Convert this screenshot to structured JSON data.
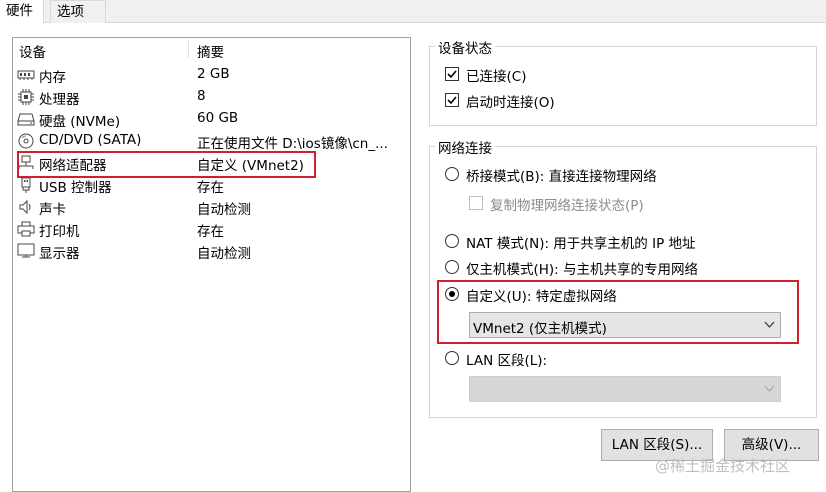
{
  "tabs": [
    {
      "label": "硬件",
      "active": true
    },
    {
      "label": "选项",
      "active": false
    }
  ],
  "device_list": {
    "headers": {
      "device": "设备",
      "summary": "摘要"
    },
    "rows": [
      {
        "icon": "memory-icon",
        "name": "内存",
        "summary": "2 GB"
      },
      {
        "icon": "processor-icon",
        "name": "处理器",
        "summary": "8"
      },
      {
        "icon": "harddisk-icon",
        "name": "硬盘 (NVMe)",
        "summary": "60 GB"
      },
      {
        "icon": "cd-dvd-icon",
        "name": "CD/DVD (SATA)",
        "summary": "正在使用文件 D:\\ios镜像\\cn_..."
      },
      {
        "icon": "network-adapter-icon",
        "name": "网络适配器",
        "summary": "自定义 (VMnet2)",
        "selected": true
      },
      {
        "icon": "usb-icon",
        "name": "USB 控制器",
        "summary": "存在"
      },
      {
        "icon": "speaker-icon",
        "name": "声卡",
        "summary": "自动检测"
      },
      {
        "icon": "printer-icon",
        "name": "打印机",
        "summary": "存在"
      },
      {
        "icon": "display-icon",
        "name": "显示器",
        "summary": "自动检测"
      }
    ]
  },
  "device_status": {
    "title": "设备状态",
    "connected": {
      "label": "已连接(C)",
      "checked": true
    },
    "connect_at_power_on": {
      "label": "启动时连接(O)",
      "checked": true
    }
  },
  "network_connection": {
    "title": "网络连接",
    "bridged": {
      "label": "桥接模式(B): 直接连接物理网络",
      "selected": false
    },
    "replicate": {
      "label": "复制物理网络连接状态(P)",
      "checked": false,
      "disabled": true
    },
    "nat": {
      "label": "NAT 模式(N): 用于共享主机的 IP 地址",
      "selected": false
    },
    "host_only": {
      "label": "仅主机模式(H): 与主机共享的专用网络",
      "selected": false
    },
    "custom": {
      "label": "自定义(U): 特定虚拟网络",
      "selected": true
    },
    "custom_select_value": "VMnet2 (仅主机模式)",
    "lan_segment": {
      "label": "LAN 区段(L):",
      "selected": false
    },
    "lan_select_value": ""
  },
  "buttons": {
    "lan_segments": "LAN 区段(S)...",
    "advanced": "高级(V)..."
  },
  "watermark": "@稀土掘金技术社区",
  "colors": {
    "highlight": "#d21f2c"
  }
}
